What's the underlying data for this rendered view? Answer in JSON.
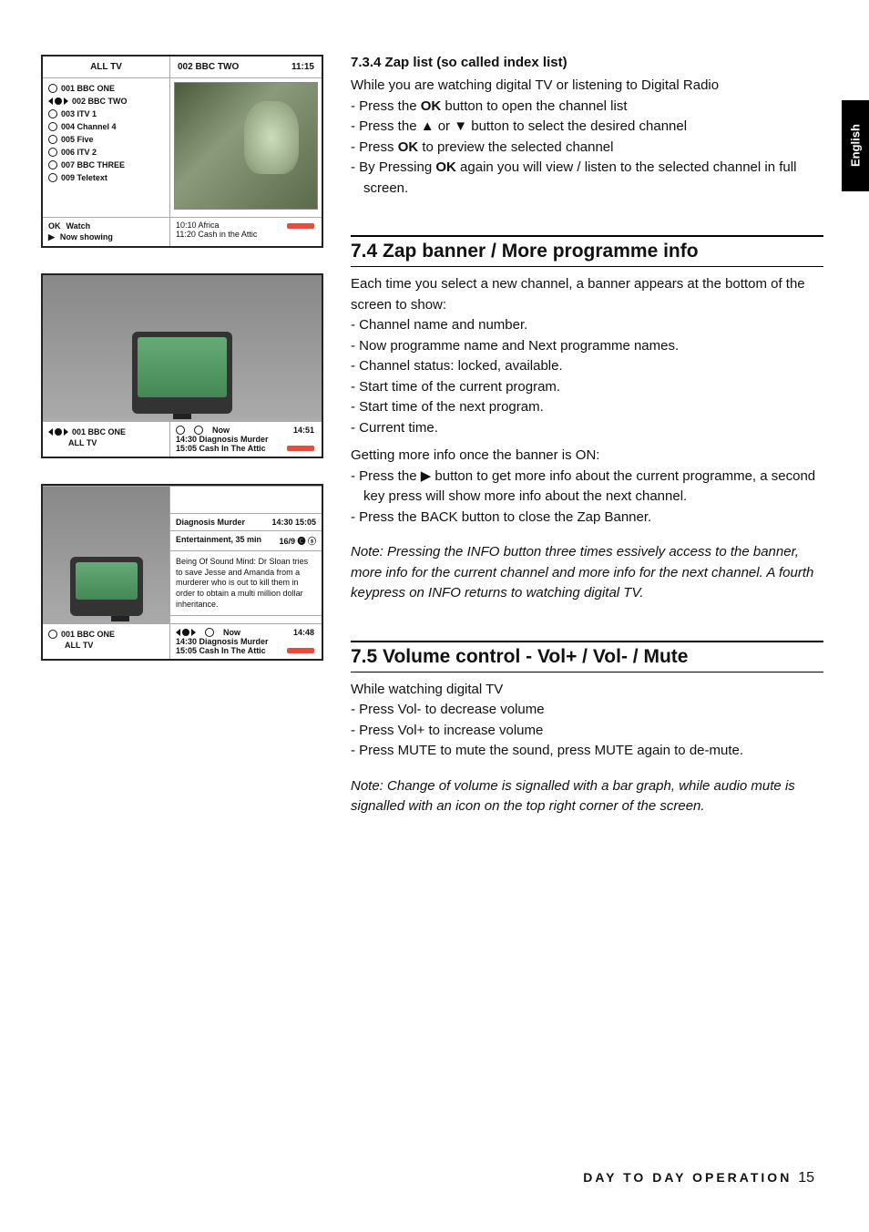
{
  "sideTab": "English",
  "shot1": {
    "topLeftLabel": "ALL TV",
    "topRightLabel": "002 BBC TWO",
    "topRightTime": "11:15",
    "channels": [
      "001 BBC ONE",
      "002 BBC TWO",
      "003 ITV 1",
      "004 Channel 4",
      "005 Five",
      "006 ITV 2",
      "007 BBC THREE",
      "009 Teletext"
    ],
    "footOK": "OK",
    "footWatch": "Watch",
    "footPlay": "▶",
    "footNow": "Now showing",
    "footRight1": "10:10 Africa",
    "footRight2": "11:20 Cash in the Attic"
  },
  "shot2": {
    "blLine1": "001 BBC ONE",
    "blLine2": "ALL TV",
    "now": "Now",
    "time": "14:51",
    "line1": "14:30 Diagnosis Murder",
    "line2": "15:05 Cash In The Attic"
  },
  "shot3": {
    "prog": "Diagnosis Murder",
    "progTime": "14:30 15:05",
    "meta": "Entertainment, 35 min",
    "metaIcons": "16/9 🅒 ⓢ",
    "desc": "Being Of Sound Mind: Dr Sloan tries to save Jesse and Amanda from a murderer who is out to kill them in order to obtain a multi million dollar inheritance.",
    "blCh": "001 BBC ONE",
    "blAll": "ALL TV",
    "now": "Now",
    "time": "14:48",
    "line1": "14:30 Diagnosis Murder",
    "line2": "15:05 Cash In The Attic"
  },
  "s734": {
    "head": "7.3.4   Zap list (so called index list)",
    "intro": "While you are watching digital TV or listening to Digital Radio",
    "b1a": "Press the ",
    "b1b": "OK",
    "b1c": " button to open the channel list",
    "b2a": "Press the  ▲  or  ▼  button to select the desired channel",
    "b3a": "Press ",
    "b3b": "OK",
    "b3c": " to preview the selected channel",
    "b4a": "By Pressing ",
    "b4b": "OK",
    "b4c": " again you will view / listen to the selected channel in full screen."
  },
  "s74": {
    "head": "7.4   Zap banner / More programme info",
    "intro": "Each time you select a new channel, a banner appears at the bottom of the screen to show:",
    "items": [
      "Channel name and number.",
      "Now programme name and Next programme names.",
      "Channel status: locked, available.",
      "Start time of the current program.",
      "Start time of the next program.",
      "Current time."
    ],
    "getting": "Getting more info once the banner is ON:",
    "g1": "Press the  ▶  button to get more info about the current programme, a second key press will show more info about the next channel.",
    "g2": "Press the BACK button to close the Zap Banner.",
    "note": "Note: Pressing the INFO button three times essively access to the banner, more info for the current channel and more info for the next channel. A fourth keypress   on INFO returns to watching digital TV."
  },
  "s75": {
    "head": "7.5   Volume control - Vol+ / Vol- / Mute",
    "intro": "While watching digital TV",
    "items": [
      "Press Vol- to decrease volume",
      "Press Vol+ to increase volume",
      "Press MUTE to mute the sound, press MUTE again to de-mute."
    ],
    "note": "Note: Change of volume is signalled with a bar graph, while audio mute is signalled with an icon on the top right corner of the screen."
  },
  "footer": {
    "label": "DAY TO DAY OPERATION",
    "page": "15"
  }
}
